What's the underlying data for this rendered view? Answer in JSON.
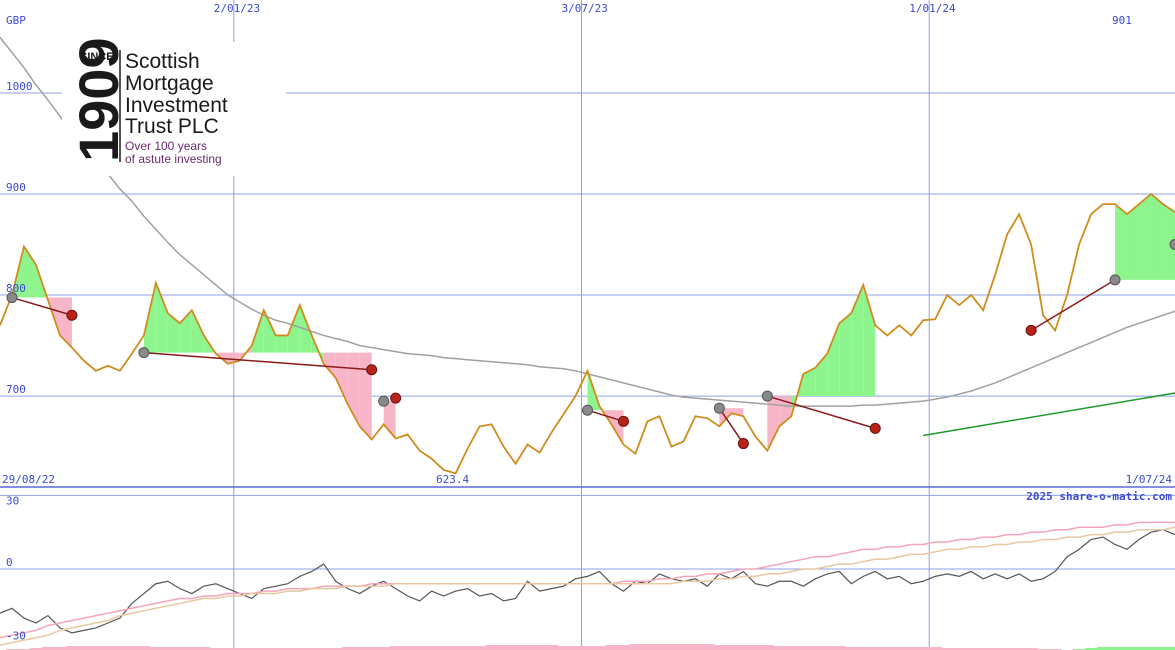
{
  "chart_data": {
    "type": "line",
    "currency": "GBP",
    "start_date": "29/08/22",
    "end_date": "1/07/24",
    "x_tick_labels": [
      "2/01/23",
      "3/07/23",
      "1/01/24"
    ],
    "price_panel": {
      "y_ticks": [
        1000,
        900,
        800,
        700
      ],
      "ylim": [
        610,
        1092
      ],
      "last_price_label": "901",
      "low_label": "623.4",
      "price": [
        770,
        800,
        848,
        830,
        795,
        760,
        748,
        735,
        725,
        730,
        725,
        742,
        760,
        812,
        782,
        772,
        785,
        760,
        742,
        732,
        735,
        750,
        785,
        760,
        760,
        790,
        760,
        732,
        718,
        692,
        670,
        657,
        672,
        658,
        662,
        646,
        638,
        627,
        623.5,
        648,
        670,
        672,
        650,
        633,
        652,
        644,
        664,
        682,
        700,
        725,
        690,
        672,
        652,
        643,
        675,
        680,
        650,
        655,
        680,
        678,
        670,
        683,
        680,
        660,
        646,
        670,
        680,
        722,
        728,
        742,
        772,
        782,
        810,
        770,
        760,
        770,
        760,
        775,
        776,
        800,
        790,
        800,
        785,
        820,
        860,
        880,
        850,
        780,
        765,
        800,
        850,
        880,
        890,
        890,
        880,
        890,
        900,
        890,
        882
      ],
      "moving_average": [
        1055,
        1040,
        1025,
        1008,
        993,
        977,
        960,
        945,
        932,
        920,
        905,
        893,
        878,
        865,
        852,
        840,
        830,
        820,
        810,
        800,
        793,
        786,
        780,
        775,
        772,
        768,
        764,
        760,
        757,
        754,
        750,
        748,
        746,
        744,
        742,
        741,
        740,
        738,
        737,
        736,
        735,
        734,
        733,
        732,
        731,
        729,
        728,
        727,
        725,
        722,
        719,
        716,
        713,
        710,
        707,
        704,
        701,
        699,
        698,
        697,
        696,
        695,
        694,
        693,
        692,
        691,
        690,
        690,
        690,
        690,
        690,
        690,
        691,
        691,
        692,
        693,
        694,
        695,
        697,
        699,
        702,
        705,
        709,
        713,
        718,
        723,
        728,
        733,
        738,
        743,
        748,
        753,
        758,
        763,
        768,
        772,
        776,
        780,
        784
      ],
      "buy_signals": [
        [
          1,
          797.5
        ],
        [
          12,
          743
        ],
        [
          32,
          695
        ],
        [
          49,
          686
        ],
        [
          60,
          688
        ],
        [
          64,
          700
        ],
        [
          93,
          815
        ],
        [
          98,
          850
        ]
      ],
      "sell_signals": [
        [
          6,
          780
        ],
        [
          31,
          726
        ],
        [
          33,
          698
        ],
        [
          52,
          675
        ],
        [
          62,
          653
        ],
        [
          73,
          668
        ],
        [
          86,
          765
        ],
        [
          104,
          839
        ]
      ],
      "trend_lines": [
        {
          "from": [
            1,
            797.5
          ],
          "to": [
            6,
            780
          ],
          "direction": "down"
        },
        {
          "from": [
            12,
            743
          ],
          "to": [
            31,
            726
          ],
          "direction": "down"
        },
        {
          "from": [
            49,
            686
          ],
          "to": [
            52,
            675
          ],
          "direction": "down"
        },
        {
          "from": [
            60,
            688
          ],
          "to": [
            62,
            653
          ],
          "direction": "down"
        },
        {
          "from": [
            64,
            700
          ],
          "to": [
            73,
            668
          ],
          "direction": "down"
        },
        {
          "from": [
            77,
            661
          ],
          "to": [
            101,
            709
          ],
          "direction": "up"
        },
        {
          "from": [
            93,
            815
          ],
          "to": [
            86,
            765
          ],
          "direction": "down"
        },
        {
          "from": [
            98,
            850
          ],
          "to": [
            104,
            839
          ],
          "direction": "down"
        }
      ]
    },
    "oscillator_panel": {
      "y_ticks": [
        30,
        0,
        -30
      ],
      "ylim": [
        -33,
        33
      ],
      "watermark": "2025 share-o-matic.com",
      "series": [
        {
          "values": [
            -18,
            -16,
            -20,
            -22,
            -19,
            -24,
            -26,
            -25,
            -24,
            -22,
            -20,
            -14,
            -10,
            -6,
            -5,
            -8,
            -10,
            -7,
            -6,
            -8,
            -10,
            -12,
            -8,
            -7,
            -6,
            -3,
            -1,
            2,
            -5,
            -8,
            -10,
            -7,
            -5,
            -8,
            -11,
            -13,
            -9,
            -11,
            -9,
            -8,
            -11,
            -10,
            -13,
            -12,
            -5,
            -9,
            -8,
            -7,
            -4,
            -3,
            -1,
            -6,
            -9,
            -5,
            -6,
            -2,
            -4,
            -5,
            -4,
            -7,
            -2,
            -4,
            -1,
            -6,
            -7,
            -5,
            -5,
            -7,
            -4,
            -2,
            -1,
            -6,
            -3,
            -1,
            -4,
            -3,
            -6,
            -5,
            -3,
            -2,
            -3,
            -1,
            -4,
            -2,
            -4,
            -2,
            -5,
            -4,
            -1,
            5,
            8,
            12,
            13,
            10,
            8,
            12,
            15,
            16,
            14,
            12
          ]
        },
        {
          "values": [
            -28,
            -27,
            -26,
            -25,
            -23,
            -22,
            -21,
            -20,
            -19,
            -18,
            -17,
            -16,
            -15,
            -14,
            -13,
            -12,
            -12,
            -11,
            -11,
            -10,
            -10,
            -10,
            -9,
            -9,
            -8,
            -8,
            -8,
            -7,
            -7,
            -7,
            -7,
            -6,
            -6,
            -6,
            -6,
            -6,
            -6,
            -6,
            -6,
            -6,
            -6,
            -6,
            -6,
            -6,
            -6,
            -6,
            -6,
            -6,
            -6,
            -6,
            -6,
            -6,
            -5,
            -5,
            -5,
            -4,
            -4,
            -3,
            -3,
            -2,
            -2,
            -1,
            0,
            0,
            1,
            2,
            3,
            4,
            5,
            5,
            6,
            7,
            8,
            8,
            9,
            9,
            10,
            10,
            11,
            11,
            12,
            12,
            13,
            13,
            14,
            14,
            15,
            15,
            16,
            16,
            17,
            17,
            17,
            18,
            18,
            19,
            19,
            19,
            19,
            19
          ]
        },
        {
          "values": [
            -31,
            -30,
            -29,
            -28,
            -27,
            -25,
            -24,
            -23,
            -22,
            -21,
            -19,
            -18,
            -17,
            -16,
            -15,
            -14,
            -13,
            -12,
            -12,
            -11,
            -11,
            -10,
            -10,
            -10,
            -9,
            -9,
            -8,
            -8,
            -8,
            -7,
            -7,
            -7,
            -7,
            -6,
            -6,
            -6,
            -6,
            -6,
            -6,
            -6,
            -6,
            -6,
            -6,
            -6,
            -6,
            -6,
            -6,
            -6,
            -6,
            -6,
            -6,
            -6,
            -6,
            -6,
            -6,
            -6,
            -6,
            -5,
            -5,
            -5,
            -4,
            -4,
            -3,
            -3,
            -2,
            -2,
            -1,
            0,
            0,
            1,
            2,
            2,
            3,
            4,
            4,
            5,
            6,
            6,
            7,
            8,
            8,
            9,
            9,
            10,
            10,
            11,
            11,
            12,
            12,
            13,
            13,
            14,
            14,
            15,
            15,
            16,
            16,
            16,
            17,
            17
          ]
        }
      ],
      "histogram": [
        0,
        -1,
        -1,
        -2,
        -3,
        -3,
        -4,
        -4,
        -4,
        -4,
        -4,
        -4,
        -4,
        -3,
        -3,
        -3,
        -3,
        -3,
        -2,
        -2,
        -2,
        -2,
        -2,
        -2,
        -2,
        -2,
        -2,
        -2,
        -2,
        -3,
        -3,
        -3,
        -3,
        -4,
        -4,
        -4,
        -4,
        -4,
        -4,
        -4,
        -4,
        -5,
        -5,
        -5,
        -5,
        -5,
        -5,
        -4,
        -4,
        -4,
        -4,
        -5,
        -5,
        -6,
        -6,
        -6,
        -6,
        -6,
        -6,
        -6,
        -5,
        -5,
        -5,
        -5,
        -5,
        -4,
        -4,
        -4,
        -4,
        -4,
        -4,
        -3,
        -3,
        -3,
        -3,
        -3,
        -3,
        -3,
        -3,
        -2,
        -2,
        -2,
        -2,
        -2,
        -2,
        -2,
        -2,
        -1,
        -1,
        0,
        1,
        2,
        3,
        3,
        3,
        3,
        3,
        3,
        3,
        3
      ]
    },
    "colors": {
      "price": "#d08c1c",
      "moving_average": "#a0a0a0",
      "gain_fill": "#8ef58e",
      "loss_fill": "#f7b6c8",
      "trend_down": "#8b1a1a",
      "trend_up": "#1f9a2a",
      "gridline": "#8fa0e8",
      "axis_text": "#3b4bd6",
      "osc_main": "#555555",
      "osc_signal": "#f4a6b8",
      "osc_slow": "#e8c8a0",
      "hist_negative": "#f7b6c8",
      "hist_positive": "#8ef58e"
    }
  },
  "logo": {
    "since": "SINCE",
    "year": "1909",
    "name_lines": [
      "Scottish",
      "Mortgage",
      "Investment",
      "Trust PLC"
    ],
    "tagline_lines": [
      "Over 100 years",
      "of astute investing"
    ]
  }
}
